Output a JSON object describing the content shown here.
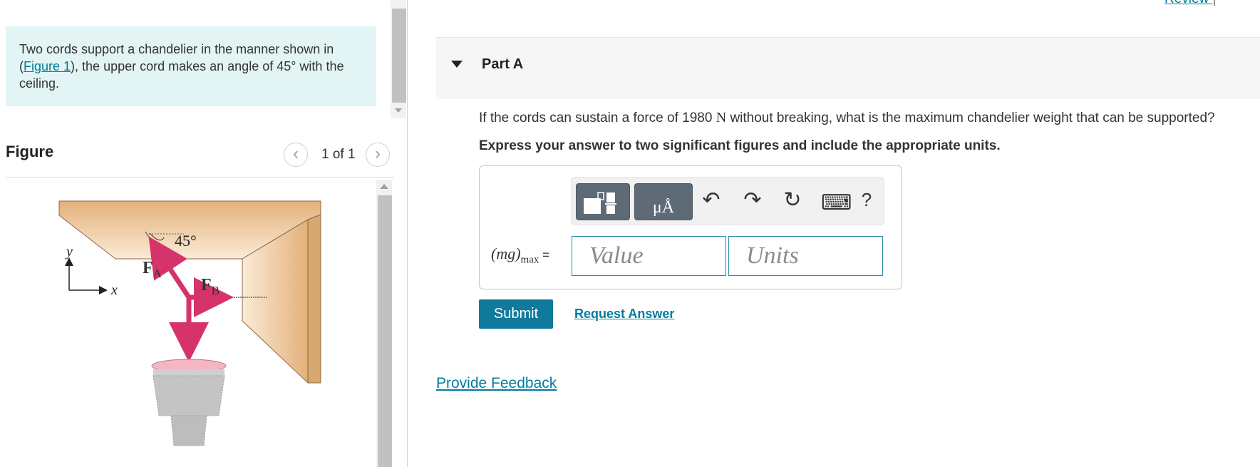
{
  "problem": {
    "text_before": "Two cords support a chandelier in the manner shown in (",
    "figure_link": "Figure 1",
    "text_after": "), the upper cord makes an angle of 45° with the ceiling."
  },
  "figure": {
    "title": "Figure",
    "counter": "1 of 1",
    "prev_glyph": "‹",
    "next_glyph": "›",
    "labels": {
      "angle": "45°",
      "force_a": "F",
      "force_a_sub": "A",
      "force_b": "F",
      "force_b_sub": "B",
      "axis_y": "y",
      "axis_x": "x"
    }
  },
  "header": {
    "review_link": "Review",
    "separator": "|"
  },
  "part": {
    "title": "Part A",
    "question_before": "If the cords can sustain a force of 1980",
    "question_unit": "N",
    "question_after": "without breaking, what is the maximum chandelier weight that can be supported?",
    "instruction": "Express your answer to two significant figures and include the appropriate units."
  },
  "toolbar": {
    "units_glyph": "μÅ",
    "undo_glyph": "↶",
    "redo_glyph": "↷",
    "reset_glyph": "↻",
    "keyboard_glyph": "⌨",
    "help_glyph": "?",
    "icons": [
      "templates-icon",
      "units-icon",
      "undo-icon",
      "redo-icon",
      "reset-icon",
      "keyboard-icon",
      "help-icon"
    ]
  },
  "answer": {
    "expression": "(mg)",
    "expression_sub": "max",
    "equals": " =",
    "value_placeholder": "Value",
    "units_placeholder": "Units"
  },
  "actions": {
    "submit": "Submit",
    "request_answer": "Request Answer",
    "provide_feedback": "Provide Feedback"
  },
  "colors": {
    "problem_bg": "#e2f4f4",
    "link": "#007c9e",
    "submit_bg": "#0f7a9c",
    "force_arrow": "#d6336c",
    "ceiling": "#e6b987"
  }
}
